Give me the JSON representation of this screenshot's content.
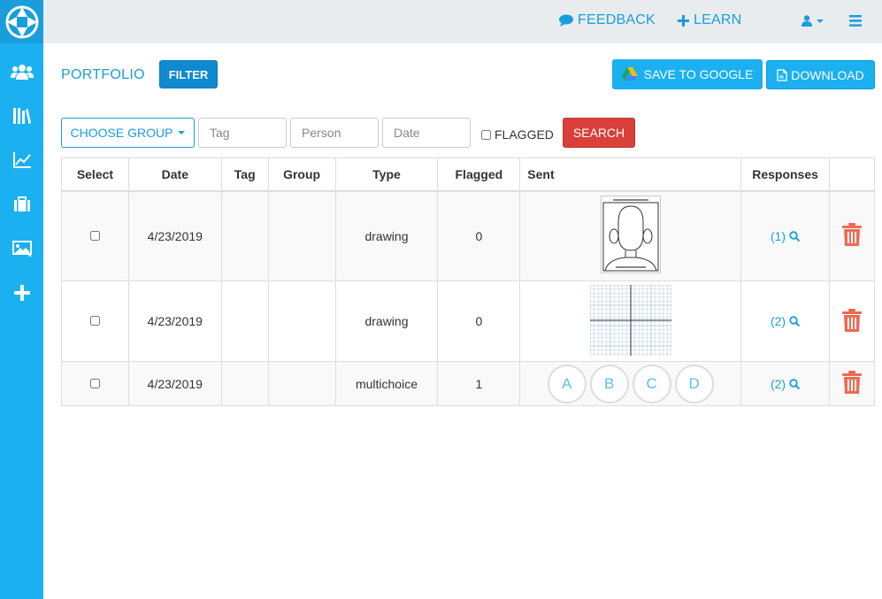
{
  "nav": {
    "feedback_label": "FEEDBACK",
    "learn_label": "LEARN"
  },
  "sidebar": {
    "items": [
      {
        "icon": "users-icon"
      },
      {
        "icon": "library-icon"
      },
      {
        "icon": "chart-line-icon"
      },
      {
        "icon": "briefcase-icon"
      },
      {
        "icon": "image-icon"
      },
      {
        "icon": "plus-icon"
      }
    ]
  },
  "page": {
    "title": "PORTFOLIO",
    "filter_label": "FILTER",
    "save_google_label": "SAVE TO GOOGLE",
    "download_label": "DOWNLOAD"
  },
  "filters": {
    "group_label": "CHOOSE GROUP",
    "tag_placeholder": "Tag",
    "person_placeholder": "Person",
    "date_placeholder": "Date",
    "flagged_label": "FLAGGED",
    "search_label": "SEARCH"
  },
  "table": {
    "headers": [
      "Select",
      "Date",
      "Tag",
      "Group",
      "Type",
      "Flagged",
      "Sent",
      "Responses"
    ],
    "rows": [
      {
        "date": "4/23/2019",
        "tag": "",
        "group": "",
        "type": "drawing",
        "flagged": "0",
        "sent": "face-drawing",
        "responses": "(1)"
      },
      {
        "date": "4/23/2019",
        "tag": "",
        "group": "",
        "type": "drawing",
        "flagged": "0",
        "sent": "graph-grid",
        "responses": "(2)"
      },
      {
        "date": "4/23/2019",
        "tag": "",
        "group": "",
        "type": "multichoice",
        "flagged": "1",
        "sent": "choices",
        "choices": [
          "A",
          "B",
          "C",
          "D"
        ],
        "responses": "(2)"
      }
    ]
  },
  "colors": {
    "sidebar": "#1bb0f0",
    "accent": "#1a9edb",
    "danger": "#d9403a",
    "trash": "#ec6a52"
  }
}
